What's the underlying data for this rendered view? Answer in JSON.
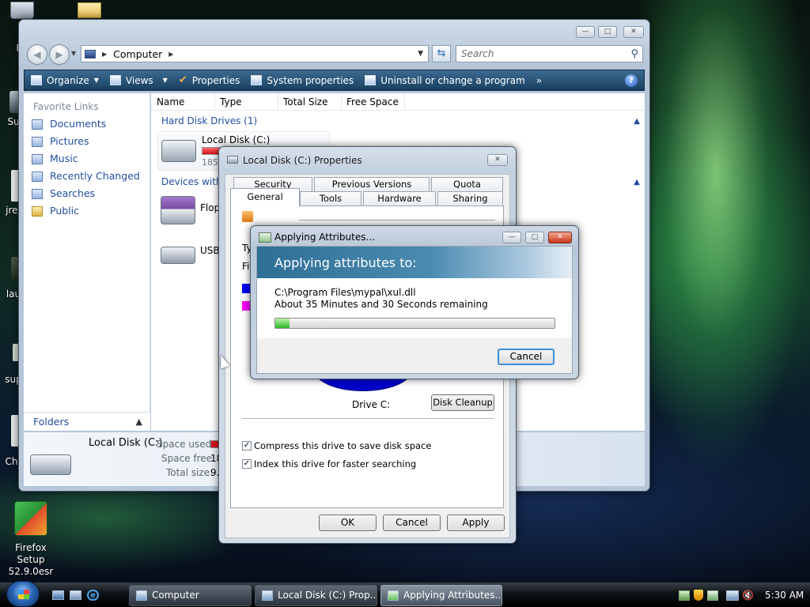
{
  "desktop": {
    "icons": [
      {
        "label": "Re"
      },
      {
        "label": "Su"
      },
      {
        "label": "jre-"
      },
      {
        "label": "lau"
      },
      {
        "label": "sup"
      },
      {
        "label": "Chr"
      },
      {
        "label": "Firefox Setup 52.9.0esr"
      }
    ]
  },
  "explorer": {
    "address": "Computer",
    "search_placeholder": "Search",
    "toolbar": {
      "organize": "Organize",
      "views": "Views",
      "properties": "Properties",
      "system_properties": "System properties",
      "uninstall": "Uninstall or change a program",
      "more": "»"
    },
    "favorite_links_title": "Favorite Links",
    "links": [
      "Documents",
      "Pictures",
      "Music",
      "Recently Changed",
      "Searches",
      "Public"
    ],
    "folders_label": "Folders",
    "columns": [
      "Name",
      "Type",
      "Total Size",
      "Free Space"
    ],
    "group_hard_disks": "Hard Disk Drives (1)",
    "group_devices": "Devices with R",
    "drive_c": {
      "name": "Local Disk (C:)",
      "detail": "185 G"
    },
    "floppy": "Flopp",
    "usb": "USBF",
    "details": {
      "name": "Local Disk (C:)",
      "space_used_label": "Space used:",
      "space_free_label": "Space free:",
      "space_free_value": "18",
      "total_size_label": "Total size:",
      "total_size_value": "9.9"
    }
  },
  "properties_dialog": {
    "title": "Local Disk (C:) Properties",
    "tabs_top": [
      "Security",
      "Previous Versions",
      "Quota"
    ],
    "tabs_bottom": [
      "General",
      "Tools",
      "Hardware",
      "Sharing"
    ],
    "partial_type": "Ty",
    "partial_fs": "Fi",
    "used_color": "#0000ff",
    "free_color": "#ff00ff",
    "drive_label": "Drive C:",
    "disk_cleanup": "Disk Cleanup",
    "compress": "Compress this drive to save disk space",
    "index": "Index this drive for faster searching",
    "ok": "OK",
    "cancel": "Cancel",
    "apply": "Apply"
  },
  "apply_dialog": {
    "title": "Applying Attributes...",
    "header": "Applying attributes to:",
    "file": "C:\\Program Files\\mypal\\xul.dll",
    "remaining": "About 35 Minutes and 30 Seconds remaining",
    "progress": 0.05,
    "cancel": "Cancel"
  },
  "taskbar": {
    "items": [
      "Computer",
      "Local Disk (C:) Prop...",
      "Applying Attributes..."
    ],
    "time": "5:30 AM"
  }
}
